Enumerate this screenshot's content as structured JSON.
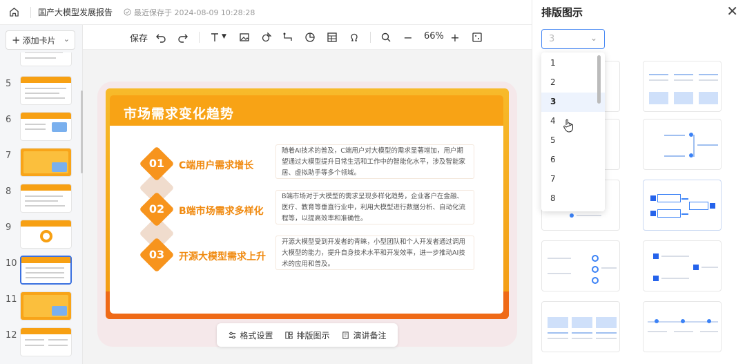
{
  "header": {
    "doc_title": "国产大模型发展报告",
    "save_status": "最近保存于 2024-08-09 10:28:28"
  },
  "sidebar": {
    "add_card": "添加卡片",
    "thumbnails": [
      "5",
      "6",
      "7",
      "8",
      "9",
      "10",
      "11",
      "12"
    ],
    "active": "10"
  },
  "toolbar": {
    "save": "保存",
    "zoom": "66%"
  },
  "slide": {
    "title": "市场需求变化趋势",
    "items": [
      {
        "num": "01",
        "title": "C端用户需求增长",
        "desc": "随着AI技术的普及，C端用户对大模型的需求显著增加，用户期望通过大模型提升日常生活和工作中的智能化水平，涉及智能家居、虚拟助手等多个领域。"
      },
      {
        "num": "02",
        "title": "B端市场需求多样化",
        "desc": "B端市场对于大模型的需求呈现多样化趋势，企业客户在金融、医疗、教育等垂直行业中，利用大模型进行数据分析、自动化流程等，以提高效率和准确性。"
      },
      {
        "num": "03",
        "title": "开源大模型需求上升",
        "desc": "开源大模型受到开发者的青睐，小型团队和个人开发者通过调用大模型的能力，提升自身技术水平和开发效率，进一步推动AI技术的应用和普及。"
      }
    ]
  },
  "bottom_tools": {
    "format": "格式设置",
    "layout": "排版图示",
    "notes": "演讲备注"
  },
  "right_panel": {
    "title": "排版图示",
    "select_value": "3",
    "options": [
      "1",
      "2",
      "3",
      "4",
      "5",
      "6",
      "7",
      "8"
    ],
    "selected_option": "3"
  }
}
